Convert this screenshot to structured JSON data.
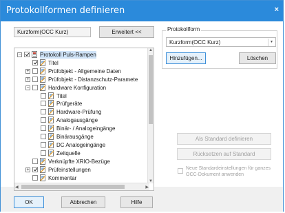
{
  "window": {
    "title": "Protokollformen definieren",
    "close_glyph": "×"
  },
  "left": {
    "profile_field": "Kurzform(OCC Kurz)",
    "expand_button": "Erweitert <<"
  },
  "tree": {
    "items": [
      {
        "label": "Protokoll Puls-Rampen",
        "level": 0,
        "expander": "−",
        "check": "checked",
        "icon": "protocol-doc-icon"
      },
      {
        "label": "Titel",
        "level": 1,
        "expander": "",
        "check": "checked",
        "icon": "doc-icon"
      },
      {
        "label": "Prüfobjekt - Allgemeine Daten",
        "level": 1,
        "expander": "+",
        "check": "unchecked",
        "icon": "doc-icon"
      },
      {
        "label": "Prüfobjekt - Distanzschutz-Paramete",
        "level": 1,
        "expander": "+",
        "check": "unchecked",
        "icon": "doc-icon"
      },
      {
        "label": "Hardware Konfiguration",
        "level": 1,
        "expander": "−",
        "check": "unchecked",
        "icon": "doc-icon"
      },
      {
        "label": "Titel",
        "level": 2,
        "expander": "",
        "check": "unchecked",
        "icon": "doc-icon"
      },
      {
        "label": "Prüfgeräte",
        "level": 2,
        "expander": "",
        "check": "unchecked",
        "icon": "doc-icon"
      },
      {
        "label": "Hardware-Prüfung",
        "level": 2,
        "expander": "",
        "check": "unchecked",
        "icon": "doc-icon"
      },
      {
        "label": "Analogausgänge",
        "level": 2,
        "expander": "",
        "check": "unchecked",
        "icon": "doc-icon"
      },
      {
        "label": "Binär- / Analogeingänge",
        "level": 2,
        "expander": "",
        "check": "unchecked",
        "icon": "doc-icon"
      },
      {
        "label": "Binärausgänge",
        "level": 2,
        "expander": "",
        "check": "unchecked",
        "icon": "doc-icon"
      },
      {
        "label": "DC Analogeingänge",
        "level": 2,
        "expander": "",
        "check": "unchecked",
        "icon": "doc-icon"
      },
      {
        "label": "Zeitquelle",
        "level": 2,
        "expander": "",
        "check": "unchecked",
        "icon": "doc-icon"
      },
      {
        "label": "Verknüpfte XRIO-Bezüge",
        "level": 1,
        "expander": "",
        "check": "unchecked",
        "icon": "doc-icon"
      },
      {
        "label": "Prüfeinstellungen",
        "level": 1,
        "expander": "+",
        "check": "checked",
        "icon": "doc-icon"
      },
      {
        "label": "Kommentar",
        "level": 1,
        "expander": "",
        "check": "unchecked",
        "icon": "doc-icon"
      }
    ]
  },
  "right": {
    "group_label": "Protokollform",
    "combo_value": "Kurzform(OCC Kurz)",
    "add_button": "Hinzufügen...",
    "delete_button": "Löschen",
    "set_default_button": "Als Standard definieren",
    "reset_default_button": "Rücksetzen auf Standard",
    "apply_checkbox_label": "Neue Standardeinstellungen für ganzes OCC-Dokument anwenden"
  },
  "footer": {
    "ok": "OK",
    "cancel": "Abbrechen",
    "help": "Hilfe"
  },
  "colors": {
    "titlebar": "#2b8adb",
    "accent_border": "#3c8fd9"
  }
}
